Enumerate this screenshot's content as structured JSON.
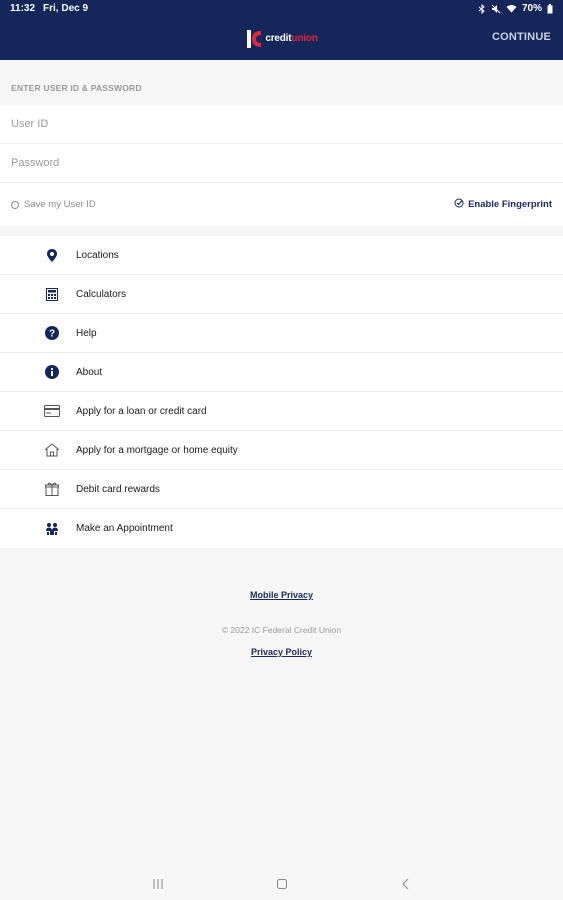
{
  "status_bar": {
    "time": "11:32",
    "date": "Fri, Dec 9",
    "battery": "70%"
  },
  "header": {
    "logo_text_part1": "credit",
    "logo_text_part2": "union",
    "continue_label": "CONTINUE"
  },
  "login": {
    "section_label": "ENTER USER ID & PASSWORD",
    "user_id_placeholder": "User ID",
    "password_placeholder": "Password",
    "save_user_id_label": "Save my User ID",
    "enable_fingerprint_label": "Enable Fingerprint"
  },
  "menu": {
    "items": [
      {
        "label": "Locations",
        "icon": "location-pin-icon"
      },
      {
        "label": "Calculators",
        "icon": "calculator-icon"
      },
      {
        "label": "Help",
        "icon": "help-icon"
      },
      {
        "label": "About",
        "icon": "info-icon"
      },
      {
        "label": "Apply for a loan or credit card",
        "icon": "credit-card-icon"
      },
      {
        "label": "Apply for a mortgage or home equity",
        "icon": "home-icon"
      },
      {
        "label": "Debit card rewards",
        "icon": "gift-icon"
      },
      {
        "label": "Make an Appointment",
        "icon": "appointment-icon"
      }
    ]
  },
  "footer": {
    "mobile_privacy": "Mobile Privacy",
    "copyright": "© 2022 IC Federal Credit Union",
    "privacy_policy": "Privacy Policy"
  },
  "colors": {
    "brand_navy": "#14265a",
    "brand_red": "#e0263b"
  }
}
